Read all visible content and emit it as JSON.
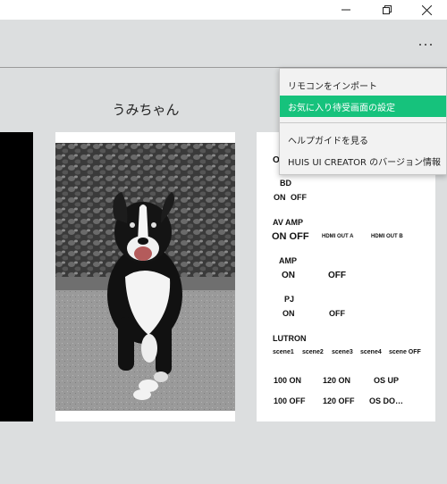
{
  "window": {
    "minimize_icon": "minimize-icon",
    "restore_icon": "restore-icon",
    "close_icon": "close-icon"
  },
  "header": {
    "more_icon": "more-icon"
  },
  "page": {
    "title": "うみちゃん"
  },
  "menu": {
    "items": [
      {
        "label": "リモコンをインポート"
      },
      {
        "label": "お気に入り待受画面の設定",
        "selected": true
      },
      {
        "label": "ヘルプガイドを見る"
      },
      {
        "label": "HUIS UI CREATOR のバージョン情報"
      }
    ],
    "accent_color": "#16c27c"
  },
  "remote": {
    "partial_title": "O",
    "bd": {
      "label": "BD",
      "on": "ON",
      "off": "OFF"
    },
    "av_amp": {
      "label": "AV AMP",
      "on_off": "ON OFF",
      "hdmi_a": "HDMI OUT A",
      "hdmi_b": "HDMI OUT B"
    },
    "amp": {
      "label": "AMP",
      "on": "ON",
      "off": "OFF"
    },
    "pj": {
      "label": "PJ",
      "on": "ON",
      "off": "OFF"
    },
    "lutron": {
      "label": "LUTRON",
      "scenes": [
        "scene1",
        "scene2",
        "scene3",
        "scene4",
        "scene OFF"
      ]
    },
    "row1": [
      "100 ON",
      "120 ON",
      "OS UP"
    ],
    "row2": [
      "100 OFF",
      "120 OFF",
      "OS DO…"
    ]
  }
}
